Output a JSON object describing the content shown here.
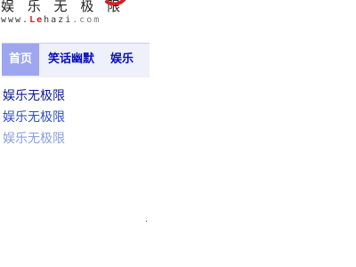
{
  "logo": {
    "chars": "娱 乐 无 极 限",
    "url_prefix": "www.",
    "url_accent": "Le",
    "url_main": "hazi",
    "url_suffix": ".com"
  },
  "nav": {
    "tabs": [
      {
        "label": "首页",
        "active": true
      },
      {
        "label": "笑话幽默",
        "active": false
      },
      {
        "label": "娱乐",
        "active": false
      }
    ]
  },
  "links": [
    {
      "label": "娱乐无极限",
      "color": "#0a1a90"
    },
    {
      "label": "娱乐无极限",
      "color": "#2d4fc4"
    },
    {
      "label": "娱乐无极限",
      "color": "#8aa0de"
    }
  ],
  "colors": {
    "nav_text": "#0a10b8",
    "nav_active_bg": "#9ea6f0",
    "nav_bg": "#eef0fa",
    "logo_accent": "#cc2222"
  }
}
